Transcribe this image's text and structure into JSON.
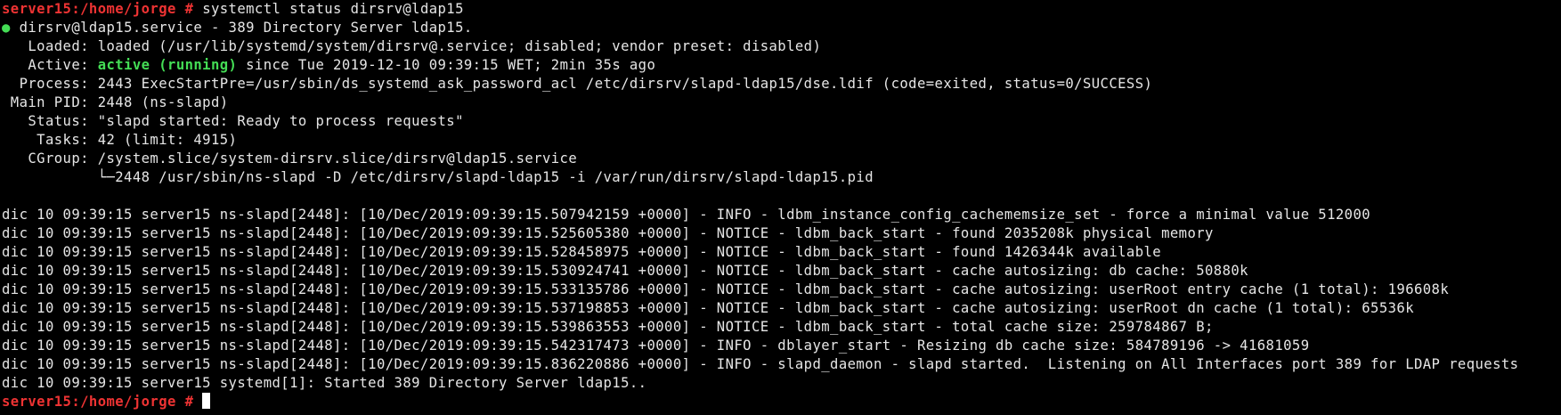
{
  "terminal": {
    "colors": {
      "background": "#000000",
      "text": "#e6e6e6",
      "prompt": "#ee3333",
      "active_state": "#44dd55",
      "bullet": "#44dd55"
    },
    "prompt": "server15:/home/jorge #",
    "command": "systemctl status dirsrv@ldap15",
    "bullet": "●",
    "unit_header": "dirsrv@ldap15.service - 389 Directory Server ldap15.",
    "loaded": "   Loaded: loaded (/usr/lib/systemd/system/dirsrv@.service; disabled; vendor preset: disabled)",
    "active_label": "   Active: ",
    "active_state": "active (running)",
    "active_since": " since Tue 2019-12-10 09:39:15 WET; 2min 35s ago",
    "process": "  Process: 2443 ExecStartPre=/usr/sbin/ds_systemd_ask_password_acl /etc/dirsrv/slapd-ldap15/dse.ldif (code=exited, status=0/SUCCESS)",
    "main_pid": " Main PID: 2448 (ns-slapd)",
    "status": "   Status: \"slapd started: Ready to process requests\"",
    "tasks": "    Tasks: 42 (limit: 4915)",
    "cgroup": "   CGroup: /system.slice/system-dirsrv.slice/dirsrv@ldap15.service",
    "cgroup_child": "           └─2448 /usr/sbin/ns-slapd -D /etc/dirsrv/slapd-ldap15 -i /var/run/dirsrv/slapd-ldap15.pid",
    "log_lines": [
      "dic 10 09:39:15 server15 ns-slapd[2448]: [10/Dec/2019:09:39:15.507942159 +0000] - INFO - ldbm_instance_config_cachememsize_set - force a minimal value 512000",
      "dic 10 09:39:15 server15 ns-slapd[2448]: [10/Dec/2019:09:39:15.525605380 +0000] - NOTICE - ldbm_back_start - found 2035208k physical memory",
      "dic 10 09:39:15 server15 ns-slapd[2448]: [10/Dec/2019:09:39:15.528458975 +0000] - NOTICE - ldbm_back_start - found 1426344k available",
      "dic 10 09:39:15 server15 ns-slapd[2448]: [10/Dec/2019:09:39:15.530924741 +0000] - NOTICE - ldbm_back_start - cache autosizing: db cache: 50880k",
      "dic 10 09:39:15 server15 ns-slapd[2448]: [10/Dec/2019:09:39:15.533135786 +0000] - NOTICE - ldbm_back_start - cache autosizing: userRoot entry cache (1 total): 196608k",
      "dic 10 09:39:15 server15 ns-slapd[2448]: [10/Dec/2019:09:39:15.537198853 +0000] - NOTICE - ldbm_back_start - cache autosizing: userRoot dn cache (1 total): 65536k",
      "dic 10 09:39:15 server15 ns-slapd[2448]: [10/Dec/2019:09:39:15.539863553 +0000] - NOTICE - ldbm_back_start - total cache size: 259784867 B;",
      "dic 10 09:39:15 server15 ns-slapd[2448]: [10/Dec/2019:09:39:15.542317473 +0000] - INFO - dblayer_start - Resizing db cache size: 584789196 -> 41681059",
      "dic 10 09:39:15 server15 ns-slapd[2448]: [10/Dec/2019:09:39:15.836220886 +0000] - INFO - slapd_daemon - slapd started.  Listening on All Interfaces port 389 for LDAP requests",
      "dic 10 09:39:15 server15 systemd[1]: Started 389 Directory Server ldap15.."
    ],
    "final_prompt": "server15:/home/jorge #",
    "final_input": ""
  }
}
